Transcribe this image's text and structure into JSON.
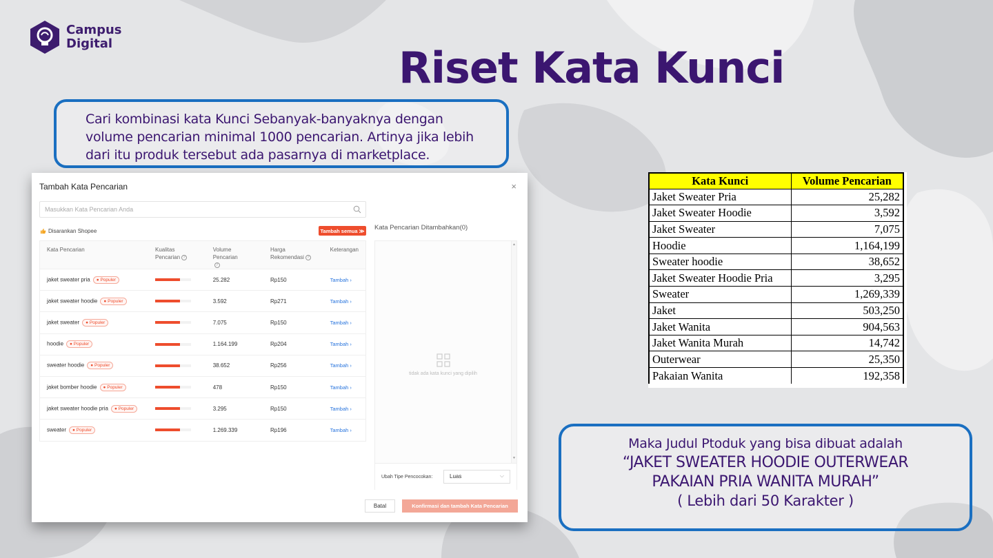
{
  "logo": {
    "line1": "Campus",
    "line2": "Digital"
  },
  "title": "Riset Kata Kunci",
  "intro_text": "Cari kombinasi kata Kunci Sebanyak-banyaknya dengan volume pencarian minimal 1000 pencarian. Artinya jika lebih dari itu produk tersebut ada pasarnya di marketplace.",
  "modal": {
    "title": "Tambah Kata Pencarian",
    "close": "×",
    "search_placeholder": "Masukkan Kata Pencarian Anda",
    "suggested_label": "Disarankan Shopee",
    "add_all_label": "Tambah semua ≫",
    "columns": {
      "keyword": "Kata Pencarian",
      "quality1": "Kualitas",
      "quality2": "Pencarian",
      "volume": "Volume Pencarian",
      "price1": "Harga",
      "price2": "Rekomendasi",
      "note": "Keterangan"
    },
    "rows": [
      {
        "keyword": "jaket sweater pria",
        "badge": "Populer",
        "quality": 0.7,
        "volume": "25.282",
        "price": "Rp150",
        "action": "Tambah ›"
      },
      {
        "keyword": "jaket sweater hoodie",
        "badge": "Populer",
        "quality": 0.7,
        "volume": "3.592",
        "price": "Rp271",
        "action": "Tambah ›"
      },
      {
        "keyword": "jaket sweater",
        "badge": "Populer",
        "quality": 0.7,
        "volume": "7.075",
        "price": "Rp150",
        "action": "Tambah ›"
      },
      {
        "keyword": "hoodie",
        "badge": "Populer",
        "quality": 0.7,
        "volume": "1.164.199",
        "price": "Rp204",
        "action": "Tambah ›"
      },
      {
        "keyword": "sweater hoodie",
        "badge": "Populer",
        "quality": 0.7,
        "volume": "38.652",
        "price": "Rp256",
        "action": "Tambah ›"
      },
      {
        "keyword": "jaket bomber hoodie",
        "badge": "Populer",
        "quality": 0.7,
        "volume": "478",
        "price": "Rp150",
        "action": "Tambah ›"
      },
      {
        "keyword": "jaket sweater hoodie pria",
        "badge": "Populer",
        "quality": 0.7,
        "volume": "3.295",
        "price": "Rp150",
        "action": "Tambah ›"
      },
      {
        "keyword": "sweater",
        "badge": "Populer",
        "quality": 0.7,
        "volume": "1.269.339",
        "price": "Rp196",
        "action": "Tambah ›"
      }
    ],
    "added_title": "Kata Pencarian Ditambahkan(0)",
    "empty_text": "tidak ada kata kunci yang dipilih",
    "match_label": "Ubah Tipe Pencocokan:",
    "match_value": "Luas",
    "cancel_label": "Batal",
    "confirm_label": "Konfirmasi dan tambah Kata Pencarian"
  },
  "keyword_table": {
    "headers": [
      "Kata Kunci",
      "Volume Pencarian"
    ],
    "rows": [
      [
        "Jaket Sweater Pria",
        "25,282"
      ],
      [
        "Jaket Sweater Hoodie",
        "3,592"
      ],
      [
        "Jaket Sweater",
        "7,075"
      ],
      [
        "Hoodie",
        "1,164,199"
      ],
      [
        "Sweater hoodie",
        "38,652"
      ],
      [
        "Jaket Sweater Hoodie Pria",
        "3,295"
      ],
      [
        "Sweater",
        "1,269,339"
      ],
      [
        "Jaket",
        "503,250"
      ],
      [
        "Jaket Wanita",
        "904,563"
      ],
      [
        "Jaket Wanita Murah",
        "14,742"
      ],
      [
        "Outerwear",
        "25,350"
      ],
      [
        "Pakaian Wanita",
        "192,358"
      ]
    ]
  },
  "conclusion": {
    "line1": "Maka Judul Ptoduk yang bisa dibuat adalah",
    "line2": "“JAKET SWEATER HOODIE OUTERWEAR",
    "line3": "PAKAIAN PRIA WANITA MURAH”",
    "line4": "( Lebih dari 50 Karakter )"
  },
  "colors": {
    "accent_purple": "#3b1670",
    "box_border": "#1a6fc1",
    "shopee_orange": "#ee4d2d",
    "header_yellow": "#ffff00",
    "link_blue": "#2673dd"
  },
  "icons": {
    "logo": "bulb-shield-icon",
    "close": "close-icon",
    "search": "search-icon",
    "suggest": "thumbs-up-icon",
    "badge": "fire-icon",
    "empty": "grid-icon",
    "select": "chevron-down-icon"
  }
}
